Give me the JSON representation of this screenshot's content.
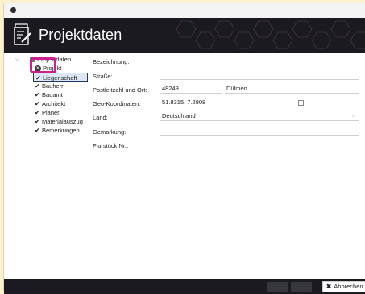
{
  "window": {
    "title": "Projektdaten"
  },
  "tree": {
    "root": "Projektdaten",
    "items": [
      {
        "label": "Projekt",
        "status": "error"
      },
      {
        "label": "Liegenschaft",
        "status": "ok",
        "selected": true
      },
      {
        "label": "Bauherr",
        "status": "ok"
      },
      {
        "label": "Bauamt",
        "status": "ok"
      },
      {
        "label": "Architekt",
        "status": "ok"
      },
      {
        "label": "Planer",
        "status": "ok"
      },
      {
        "label": "Materialauszug",
        "status": "ok"
      },
      {
        "label": "Bemerkungen",
        "status": "ok"
      }
    ]
  },
  "form": {
    "bezeichnung_label": "Bezeichnung:",
    "bezeichnung_value": "",
    "strasse_label": "Straße:",
    "strasse_value": "",
    "plz_ort_label": "Postleitzahl und Ort:",
    "plz_value": "48249",
    "ort_value": "Dülmen",
    "geo_label": "Geo-Koordinaten:",
    "geo_value": "51.8315, 7.2808",
    "land_label": "Land:",
    "land_value": "Deutschland",
    "gemarkung_label": "Gemarkung:",
    "gemarkung_value": "",
    "flurstueck_label": "Flurstück Nr.:",
    "flurstueck_value": ""
  },
  "footer": {
    "cancel_label": "Abbrechen"
  },
  "colors": {
    "header_bg": "#1a1a20",
    "highlight": "#cc1e8c",
    "selection_border": "#1f3b63",
    "page_bg": "#fdf2d0"
  }
}
